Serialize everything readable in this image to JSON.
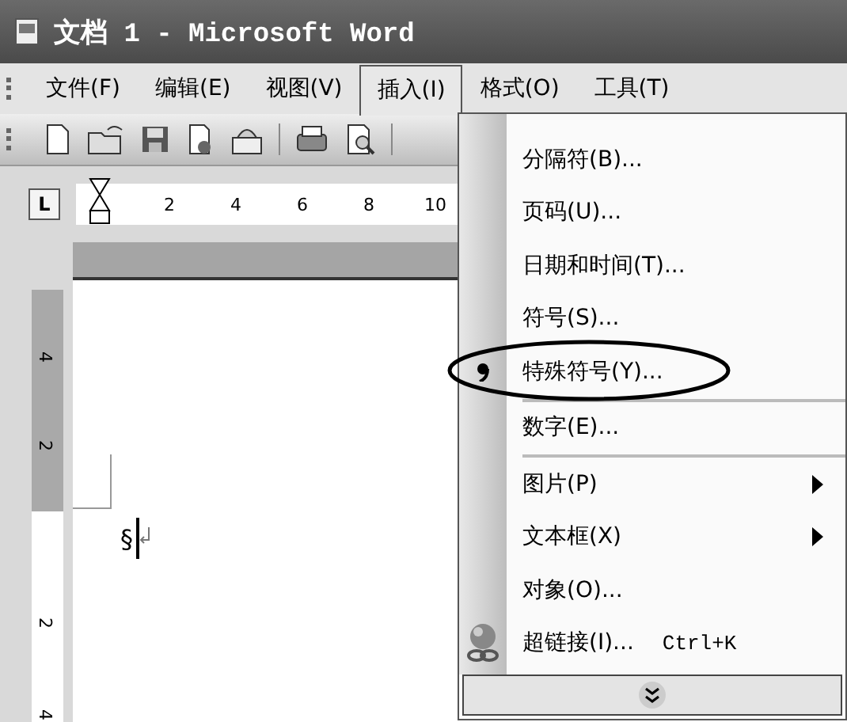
{
  "window": {
    "title": "文档 1 - Microsoft Word"
  },
  "menu_bar": [
    {
      "label": "文件(F)",
      "selected": false
    },
    {
      "label": "编辑(E)",
      "selected": false
    },
    {
      "label": "视图(V)",
      "selected": false
    },
    {
      "label": "插入(I)",
      "selected": true
    },
    {
      "label": "格式(O)",
      "selected": false
    },
    {
      "label": "工具(T)",
      "selected": false
    }
  ],
  "ruler": {
    "tab_stop": "L",
    "numbers": [
      "2",
      "4",
      "6",
      "8",
      "10"
    ]
  },
  "vertical_ruler": {
    "numbers": [
      "4",
      "2",
      "2",
      "4"
    ]
  },
  "document": {
    "mark": "§"
  },
  "insert_menu": {
    "items": [
      {
        "kind": "plain",
        "label": "分隔符(B)...",
        "circled": false,
        "separator_after": false
      },
      {
        "kind": "plain",
        "label": "页码(U)...",
        "circled": false,
        "separator_after": false
      },
      {
        "kind": "plain",
        "label": "日期和时间(T)...",
        "circled": false,
        "separator_after": false
      },
      {
        "kind": "plain",
        "label": "符号(S)...",
        "circled": false,
        "separator_after": false
      },
      {
        "kind": "symbol",
        "label": "特殊符号(Y)...",
        "circled": true,
        "separator_after": true
      },
      {
        "kind": "plain",
        "label": "数字(E)...",
        "circled": false,
        "separator_after": true
      },
      {
        "kind": "submenu",
        "label": "图片(P)",
        "circled": false,
        "separator_after": false
      },
      {
        "kind": "submenu",
        "label": "文本框(X)",
        "circled": false,
        "separator_after": false
      },
      {
        "kind": "plain",
        "label": "对象(O)...",
        "circled": false,
        "separator_after": false
      },
      {
        "kind": "link",
        "label": "超链接(I)...",
        "shortcut": "Ctrl+K",
        "circled": false,
        "separator_after": false
      }
    ]
  }
}
